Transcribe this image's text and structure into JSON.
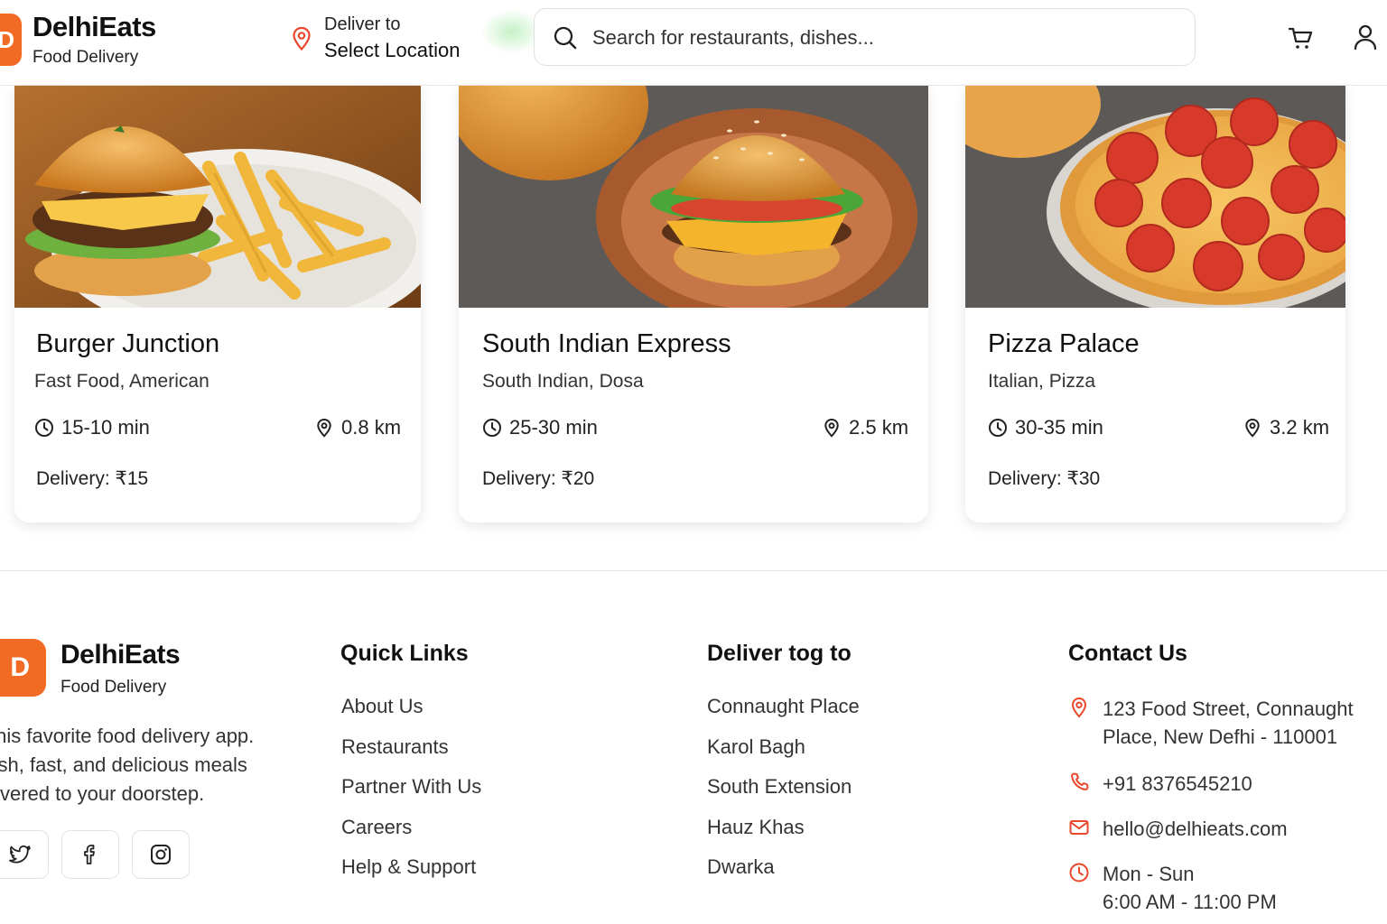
{
  "header": {
    "logo_letter": "D",
    "brand_name": "DelhiEats",
    "brand_tagline": "Food Delivery",
    "deliver_label": "Deliver to",
    "location_value": "Select Location",
    "search_placeholder": "Search for restaurants, dishes...",
    "icons": [
      "map-pin-icon",
      "search-icon",
      "cart-icon",
      "user-icon"
    ]
  },
  "restaurants": [
    {
      "name": "Burger Junction",
      "cuisine": "Fast Food, American",
      "time": "15-10 min",
      "distance": "0.8 km",
      "delivery": "Delivery: ₹15"
    },
    {
      "name": "South Indian Express",
      "cuisine": "South Indian, Dosa",
      "time": "25-30 min",
      "distance": "2.5 km",
      "delivery": "Delivery: ₹20"
    },
    {
      "name": "Pizza Palace",
      "cuisine": "Italian, Pizza",
      "time": "30-35 min",
      "distance": "3.2 km",
      "delivery": "Delivery: ₹30"
    }
  ],
  "footer": {
    "logo_letter": "D",
    "brand_name": "DelhiEats",
    "brand_tagline": "Food Delivery",
    "description": "elhis favorite food delivery app. resh, fast, and delicious meals elivered to your doorstep.",
    "description_lines": [
      "elhis favorite food delivery app.",
      "resh, fast, and delicious meals",
      "elivered to your doorstep."
    ],
    "social_icons": [
      "twitter-icon",
      "facebook-icon",
      "instagram-icon"
    ],
    "quick_links": {
      "title": "Quick Links",
      "items": [
        "About Us",
        "Restaurants",
        "Partner With Us",
        "Careers",
        "Help & Support"
      ]
    },
    "deliver_to": {
      "title": "Deliver tog to",
      "items": [
        "Connaught Place",
        "Karol Bagh",
        "South Extension",
        "Hauz Khas",
        "Dwarka"
      ]
    },
    "contact": {
      "title": "Contact Us",
      "address": "123 Food Street, Connaught\nPlace, New Defhi - 110001",
      "phone": "+91 8376545210",
      "email": "hello@delhieats.com",
      "hours": "Mon - Sun\n6:00 AM - 11:00 PM"
    }
  },
  "colors": {
    "accent": "#f26b25",
    "contact_icon": "#e8472c",
    "text": "#111111"
  }
}
